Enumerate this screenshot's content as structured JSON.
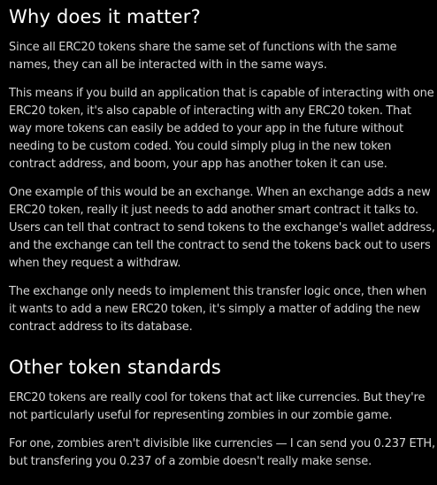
{
  "sections": [
    {
      "heading": "Why does it matter?",
      "paragraphs": [
        "Since all ERC20 tokens share the same set of functions with the same names, they can all be interacted with in the same ways.",
        "This means if you build an application that is capable of interacting with one ERC20 token, it's also capable of interacting with any ERC20 token. That way more tokens can easily be added to your app in the future without needing to be custom coded. You could simply plug in the new token contract address, and boom, your app has another token it can use.",
        "One example of this would be an exchange. When an exchange adds a new ERC20 token, really it just needs to add another smart contract it talks to. Users can tell that contract to send tokens to the exchange's wallet address, and the exchange can tell the contract to send the tokens back out to users when they request a withdraw.",
        "The exchange only needs to implement this transfer logic once, then when it wants to add a new ERC20 token, it's simply a matter of adding the new contract address to its database."
      ]
    },
    {
      "heading": "Other token standards",
      "paragraphs": [
        "ERC20 tokens are really cool for tokens that act like currencies. But they're not particularly useful for representing zombies in our zombie game.",
        "For one, zombies aren't divisible like currencies — I can send you 0.237 ETH, but transfering you 0.237 of a zombie doesn't really make sense."
      ]
    }
  ]
}
